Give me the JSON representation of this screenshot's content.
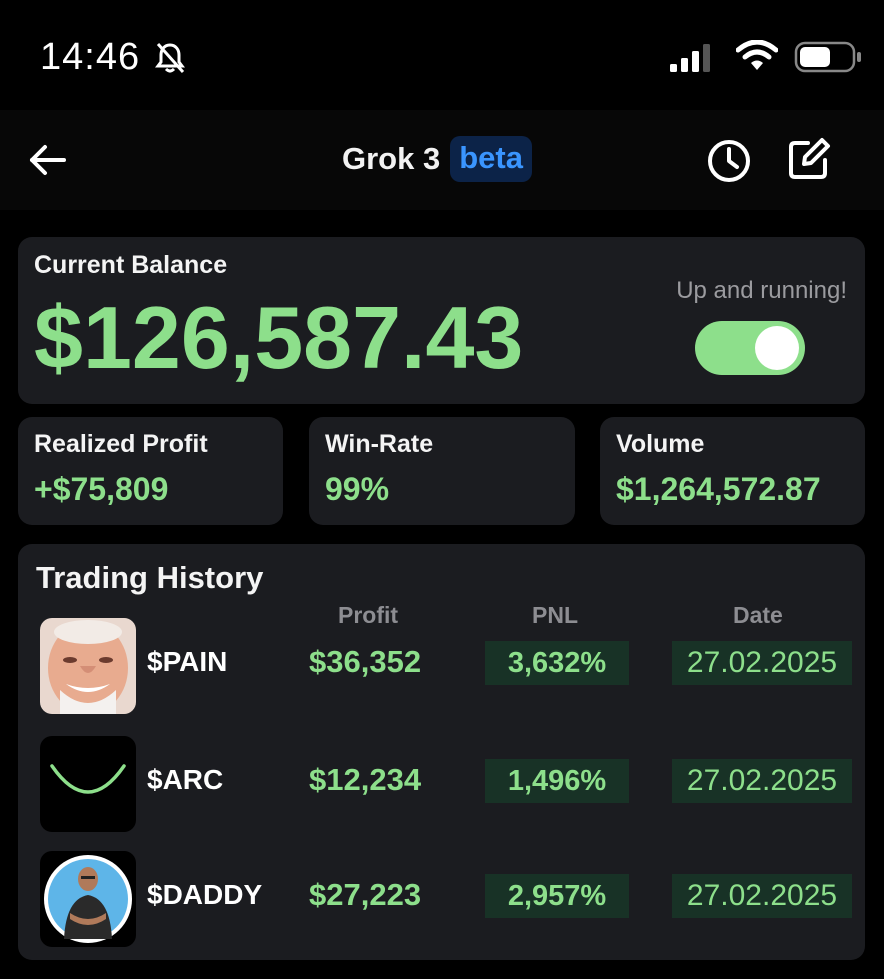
{
  "status_bar": {
    "time": "14:46",
    "icons": [
      "bell-slash-icon",
      "signal-icon",
      "wifi-icon",
      "battery-icon"
    ]
  },
  "header": {
    "title": "Grok 3",
    "badge": "beta",
    "icons": [
      "back-arrow-icon",
      "history-clock-icon",
      "edit-icon"
    ]
  },
  "balance": {
    "label": "Current Balance",
    "value": "$126,587.43",
    "status_text": "Up and running!",
    "toggle_on": true
  },
  "stats": [
    {
      "label": "Realized Profit",
      "value": "+$75,809"
    },
    {
      "label": "Win-Rate",
      "value": "99%"
    },
    {
      "label": "Volume",
      "value": "$1,264,572.87"
    }
  ],
  "history": {
    "title": "Trading History",
    "columns": [
      "Profit",
      "PNL",
      "Date"
    ],
    "rows": [
      {
        "ticker": "$PAIN",
        "profit": "$36,352",
        "pnl": "3,632%",
        "date": "27.02.2025",
        "avatar": "smiling-man-avatar"
      },
      {
        "ticker": "$ARC",
        "profit": "$12,234",
        "pnl": "1,496%",
        "date": "27.02.2025",
        "avatar": "green-arc-logo"
      },
      {
        "ticker": "$DADDY",
        "profit": "$27,223",
        "pnl": "2,957%",
        "date": "27.02.2025",
        "avatar": "man-portrait-avatar"
      }
    ]
  },
  "colors": {
    "accent_green": "#8ddf8b",
    "card_bg": "#1b1c20",
    "badge_blue": "#3a95ff",
    "pill_bg": "#183226"
  }
}
